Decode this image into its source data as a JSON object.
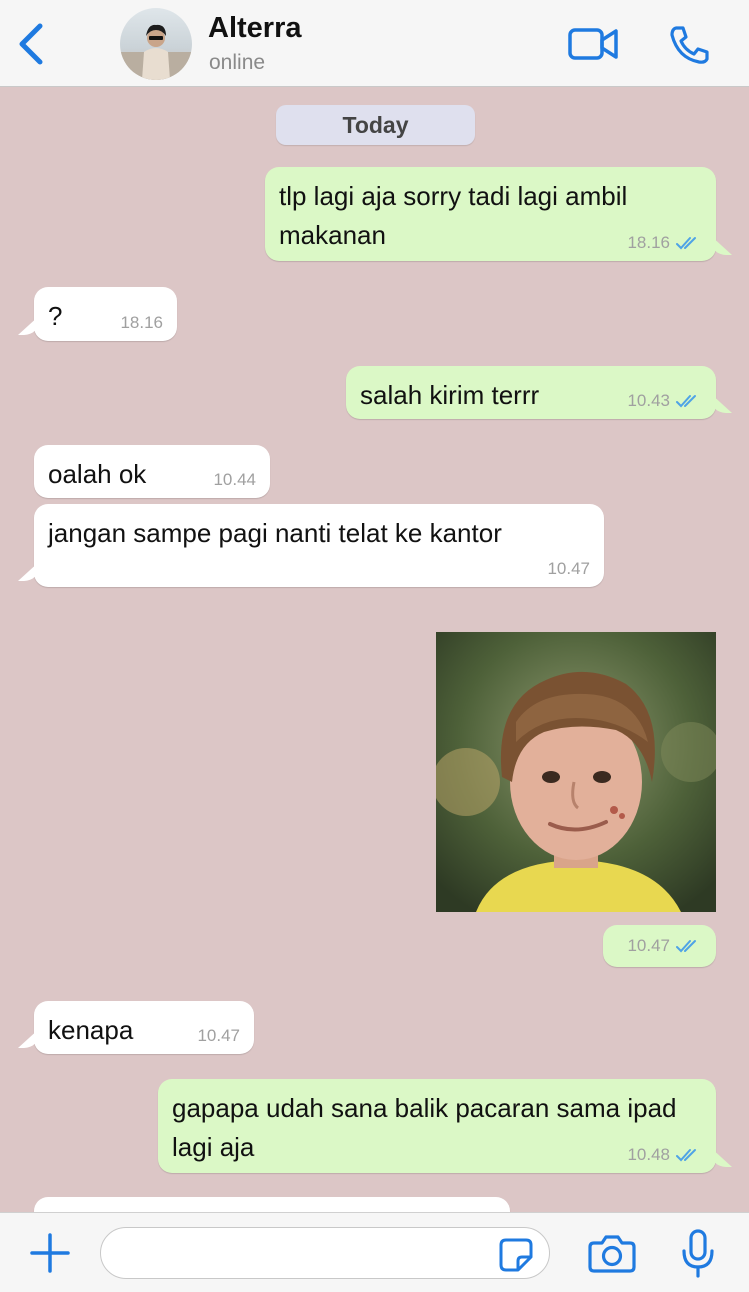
{
  "header": {
    "contact_name": "Alterra",
    "status": "online"
  },
  "date_divider": "Today",
  "messages": [
    {
      "direction": "outgoing",
      "text": "tlp lagi aja sorry tadi lagi ambil makanan",
      "time": "18.16",
      "read": true
    },
    {
      "direction": "incoming",
      "text": "?",
      "time": "18.16"
    },
    {
      "direction": "outgoing",
      "text": "salah kirim terrr",
      "time": "10.43",
      "read": true
    },
    {
      "direction": "incoming",
      "text": "oalah ok",
      "time": "10.44"
    },
    {
      "direction": "incoming",
      "text": "jangan sampe pagi nanti telat ke kantor",
      "time": "10.47"
    },
    {
      "direction": "outgoing",
      "type": "image",
      "time": "10.47",
      "read": true
    },
    {
      "direction": "incoming",
      "text": "kenapa",
      "time": "10.47"
    },
    {
      "direction": "outgoing",
      "text": "gapapa udah sana balik pacaran sama ipad lagi aja",
      "time": "10.48",
      "read": true
    }
  ],
  "composer": {
    "placeholder": ""
  },
  "colors": {
    "chat_background": "#dcc6c6",
    "outgoing_bubble": "#dbf8c6",
    "incoming_bubble": "#ffffff",
    "accent": "#1f7ae0",
    "read_ticks": "#4fa3e6"
  },
  "icons": {
    "back": "chevron-left-icon",
    "video": "video-camera-icon",
    "call": "phone-icon",
    "attach": "plus-icon",
    "sticker": "sticker-icon",
    "camera": "camera-icon",
    "mic": "microphone-icon"
  }
}
